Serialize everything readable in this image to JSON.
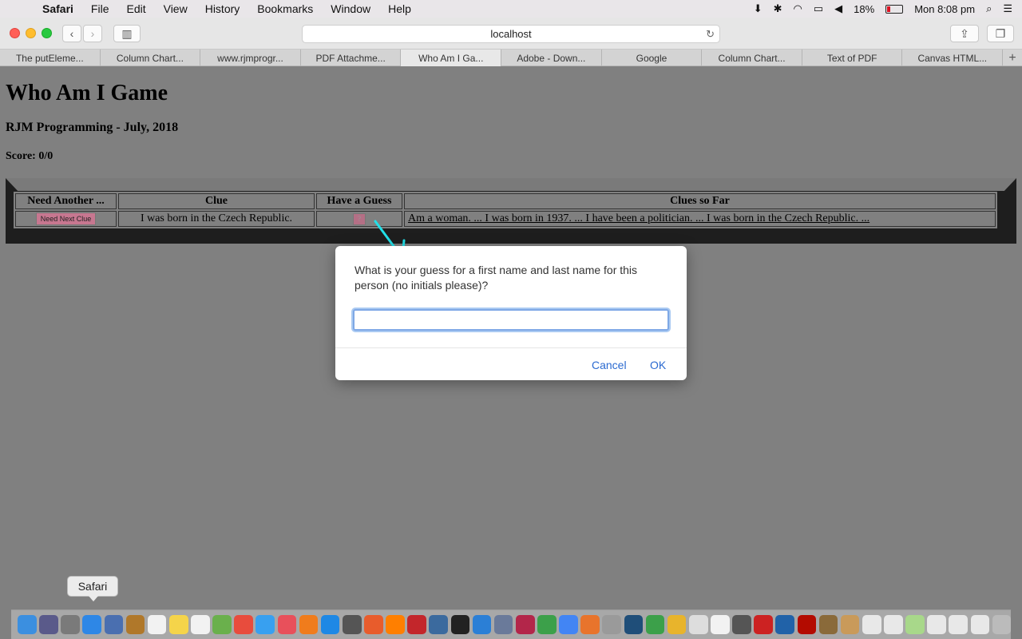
{
  "menubar": {
    "app": "Safari",
    "items": [
      "File",
      "Edit",
      "View",
      "History",
      "Bookmarks",
      "Window",
      "Help"
    ],
    "battery": "18%",
    "clock": "Mon 8:08 pm"
  },
  "toolbar": {
    "address": "localhost"
  },
  "tabs": [
    {
      "label": "The putEleme..."
    },
    {
      "label": "Column Chart..."
    },
    {
      "label": "www.rjmprogr..."
    },
    {
      "label": "PDF Attachme..."
    },
    {
      "label": "Who Am I Ga..."
    },
    {
      "label": "Adobe - Down..."
    },
    {
      "label": "Google"
    },
    {
      "label": "Column Chart..."
    },
    {
      "label": "Text of PDF"
    },
    {
      "label": "Canvas HTML..."
    }
  ],
  "page": {
    "title": "Who Am I Game",
    "subtitle": "RJM Programming - July, 2018",
    "score": "Score: 0/0",
    "table": {
      "headers": [
        "Need Another ...",
        "Clue",
        "Have a Guess",
        "Clues so Far"
      ],
      "next_button": "Need Next Clue",
      "clue": "I was born in the Czech Republic.",
      "guess_button": "?",
      "clues_so_far": "Am a woman. ... I was born in 1937. ... I have been a politician. ... I was born in the Czech Republic. ..."
    }
  },
  "dialog": {
    "message": "What is your guess for a first name and last name for this person (no initials please)?",
    "input_value": "",
    "cancel": "Cancel",
    "ok": "OK"
  },
  "dock": {
    "tooltip": "Safari",
    "icon_colors": [
      "#3b8fe0",
      "#5a5a8a",
      "#7a7a7a",
      "#2e87e6",
      "#4a6fb0",
      "#b0782a",
      "#f2f2f2",
      "#f5d44a",
      "#f2f2f2",
      "#6ab04c",
      "#e84c3d",
      "#38a0f0",
      "#e8505b",
      "#f07c1c",
      "#1e88e5",
      "#555555",
      "#e85c2c",
      "#ff7f00",
      "#c3262b",
      "#3b6a9e",
      "#222222",
      "#2b7fd6",
      "#6a7a9a",
      "#b3264a",
      "#3ca04a",
      "#4285f4",
      "#e8742c",
      "#9a9a9a",
      "#1f4e79",
      "#3ca04a",
      "#e8b42c",
      "#dddddd",
      "#f2f2f2",
      "#555555",
      "#cc2222",
      "#2162a8",
      "#b30b00",
      "#8a6a3a",
      "#c99a5a",
      "#e8e8e8",
      "#e8e8e8",
      "#a8d88a",
      "#e8e8e8",
      "#e8e8e8",
      "#e8e8e8",
      "#bbbbbb"
    ]
  }
}
